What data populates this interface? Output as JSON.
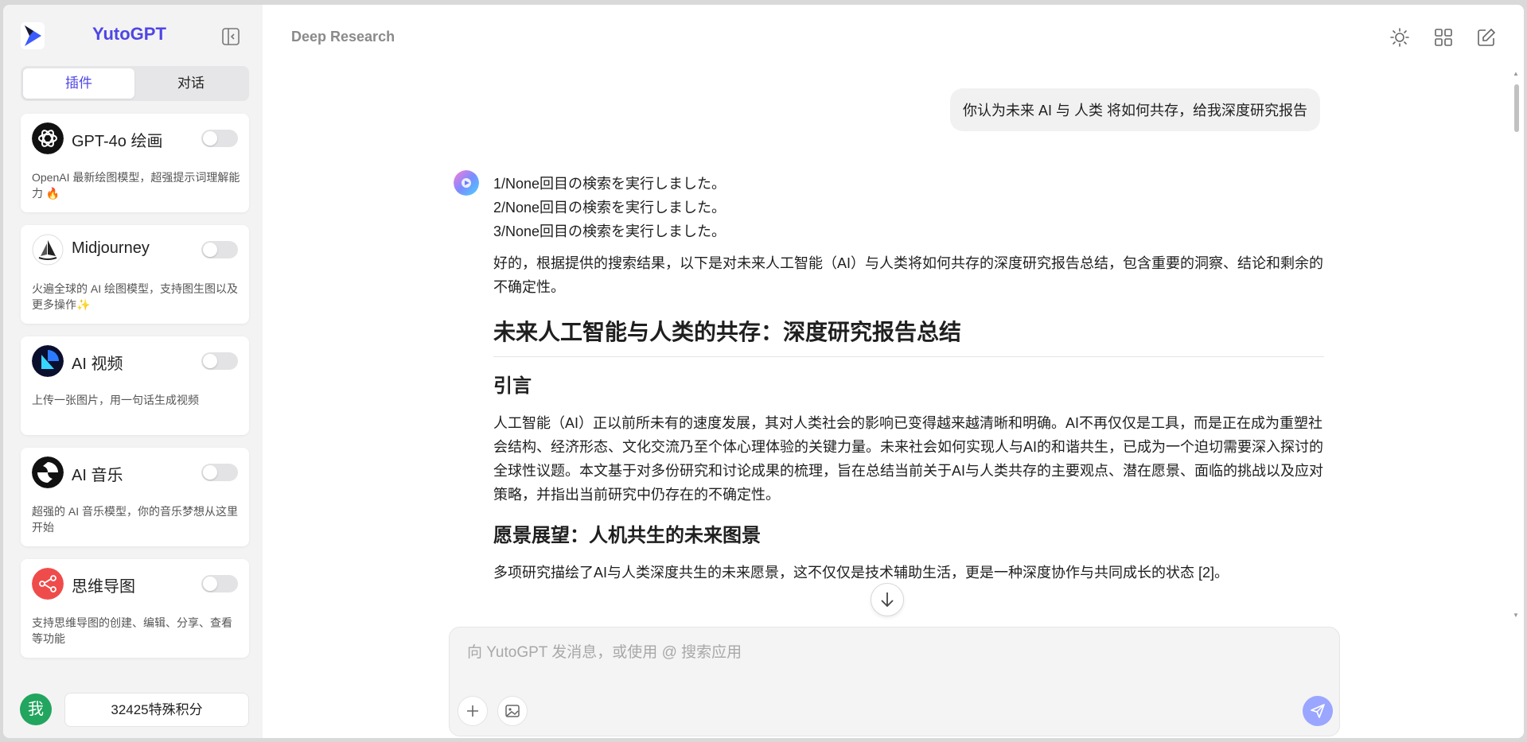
{
  "sidebar": {
    "brand": "YutoGPT",
    "tabs": [
      {
        "label": "插件",
        "active": true
      },
      {
        "label": "对话",
        "active": false
      }
    ],
    "plugins": [
      {
        "name": "GPT-4o 绘画",
        "desc": "OpenAI 最新绘图模型，超强提示词理解能力 🔥",
        "icon": "openai-icon",
        "enabled": false
      },
      {
        "name": "Midjourney",
        "desc": "火遍全球的 AI 绘图模型，支持图生图以及更多操作✨",
        "icon": "midjourney-icon",
        "enabled": false
      },
      {
        "name": "AI 视频",
        "desc": "上传一张图片，用一句话生成视频",
        "icon": "video-icon",
        "enabled": false
      },
      {
        "name": "AI 音乐",
        "desc": "超强的 AI 音乐模型，你的音乐梦想从这里开始",
        "icon": "music-icon",
        "enabled": false
      },
      {
        "name": "思维导图",
        "desc": "支持思维导图的创建、编辑、分享、查看等功能",
        "icon": "mindmap-icon",
        "enabled": false
      }
    ],
    "user_avatar": "我",
    "credits": "32425特殊积分"
  },
  "header": {
    "title": "Deep Research"
  },
  "chat": {
    "user_message": "你认为未来 AI 与 人类 将如何共存，给我深度研究报告",
    "search_lines": [
      "1/None回目の検索を実行しました。",
      "2/None回目の検索を実行しました。",
      "3/None回目の検索を実行しました。"
    ],
    "intro": "好的，根据提供的搜索结果，以下是对未来人工智能（AI）与人类将如何共存的深度研究报告总结，包含重要的洞察、结论和剩余的不确定性。",
    "report_title": "未来人工智能与人类的共存：深度研究报告总结",
    "section1_heading": "引言",
    "section1_body": "人工智能（AI）正以前所未有的速度发展，其对人类社会的影响已变得越来越清晰和明确。AI不再仅仅是工具，而是正在成为重塑社会结构、经济形态、文化交流乃至个体心理体验的关键力量。未来社会如何实现人与AI的和谐共生，已成为一个迫切需要深入探讨的全球性议题。本文基于对多份研究和讨论成果的梳理，旨在总结当前关于AI与人类共存的主要观点、潜在愿景、面临的挑战以及应对策略，并指出当前研究中仍存在的不确定性。",
    "section2_heading": "愿景展望：人机共生的未来图景",
    "section2_body": "多项研究描绘了AI与人类深度共生的未来愿景，这不仅仅是技术辅助生活，更是一种深度协作与共同成长的状态 [2]。"
  },
  "composer": {
    "placeholder": "向 YutoGPT 发消息，或使用 @ 搜索应用"
  },
  "colors": {
    "accent": "#4f46e5",
    "send": "#9aa6ff",
    "avatar": "#22a55e"
  }
}
